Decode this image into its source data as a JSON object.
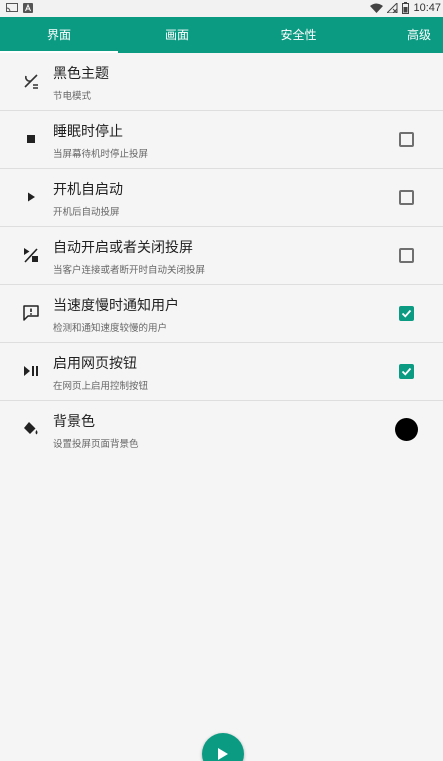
{
  "status_bar": {
    "time": "10:47",
    "left_icons": [
      "cast-icon",
      "notification-a-icon"
    ],
    "right_icons": [
      "wifi-icon",
      "signal-off-icon",
      "battery-icon"
    ]
  },
  "tabs": [
    {
      "label": "界面",
      "active": true
    },
    {
      "label": "画面",
      "active": false
    },
    {
      "label": "安全性",
      "active": false
    },
    {
      "label": "高级",
      "active": false
    }
  ],
  "settings": [
    {
      "icon": "dark-theme-icon",
      "title": "黑色主题",
      "subtitle": "节电模式",
      "control": "none"
    },
    {
      "icon": "stop-icon",
      "title": "睡眠时停止",
      "subtitle": "当屏幕待机时停止投屏",
      "control": "checkbox",
      "checked": false
    },
    {
      "icon": "play-icon",
      "title": "开机自启动",
      "subtitle": "开机后自动投屏",
      "control": "checkbox",
      "checked": false
    },
    {
      "icon": "auto-toggle-icon",
      "title": "自动开启或者关闭投屏",
      "subtitle": "当客户连接或者断开时自动关闭投屏",
      "control": "checkbox",
      "checked": false
    },
    {
      "icon": "notify-message-icon",
      "title": "当速度慢时通知用户",
      "subtitle": "检测和通知速度较慢的用户",
      "control": "checkbox",
      "checked": true
    },
    {
      "icon": "play-pause-icon",
      "title": "启用网页按钮",
      "subtitle": "在网页上启用控制按钮",
      "control": "checkbox",
      "checked": true
    },
    {
      "icon": "paint-bucket-icon",
      "title": "背景色",
      "subtitle": "设置投屏页面背景色",
      "control": "color",
      "color": "#000000"
    }
  ],
  "fab": {
    "icon": "play-icon"
  },
  "colors": {
    "accent": "#0b9b83",
    "background": "#f5f5f5",
    "divider": "#dedede"
  }
}
